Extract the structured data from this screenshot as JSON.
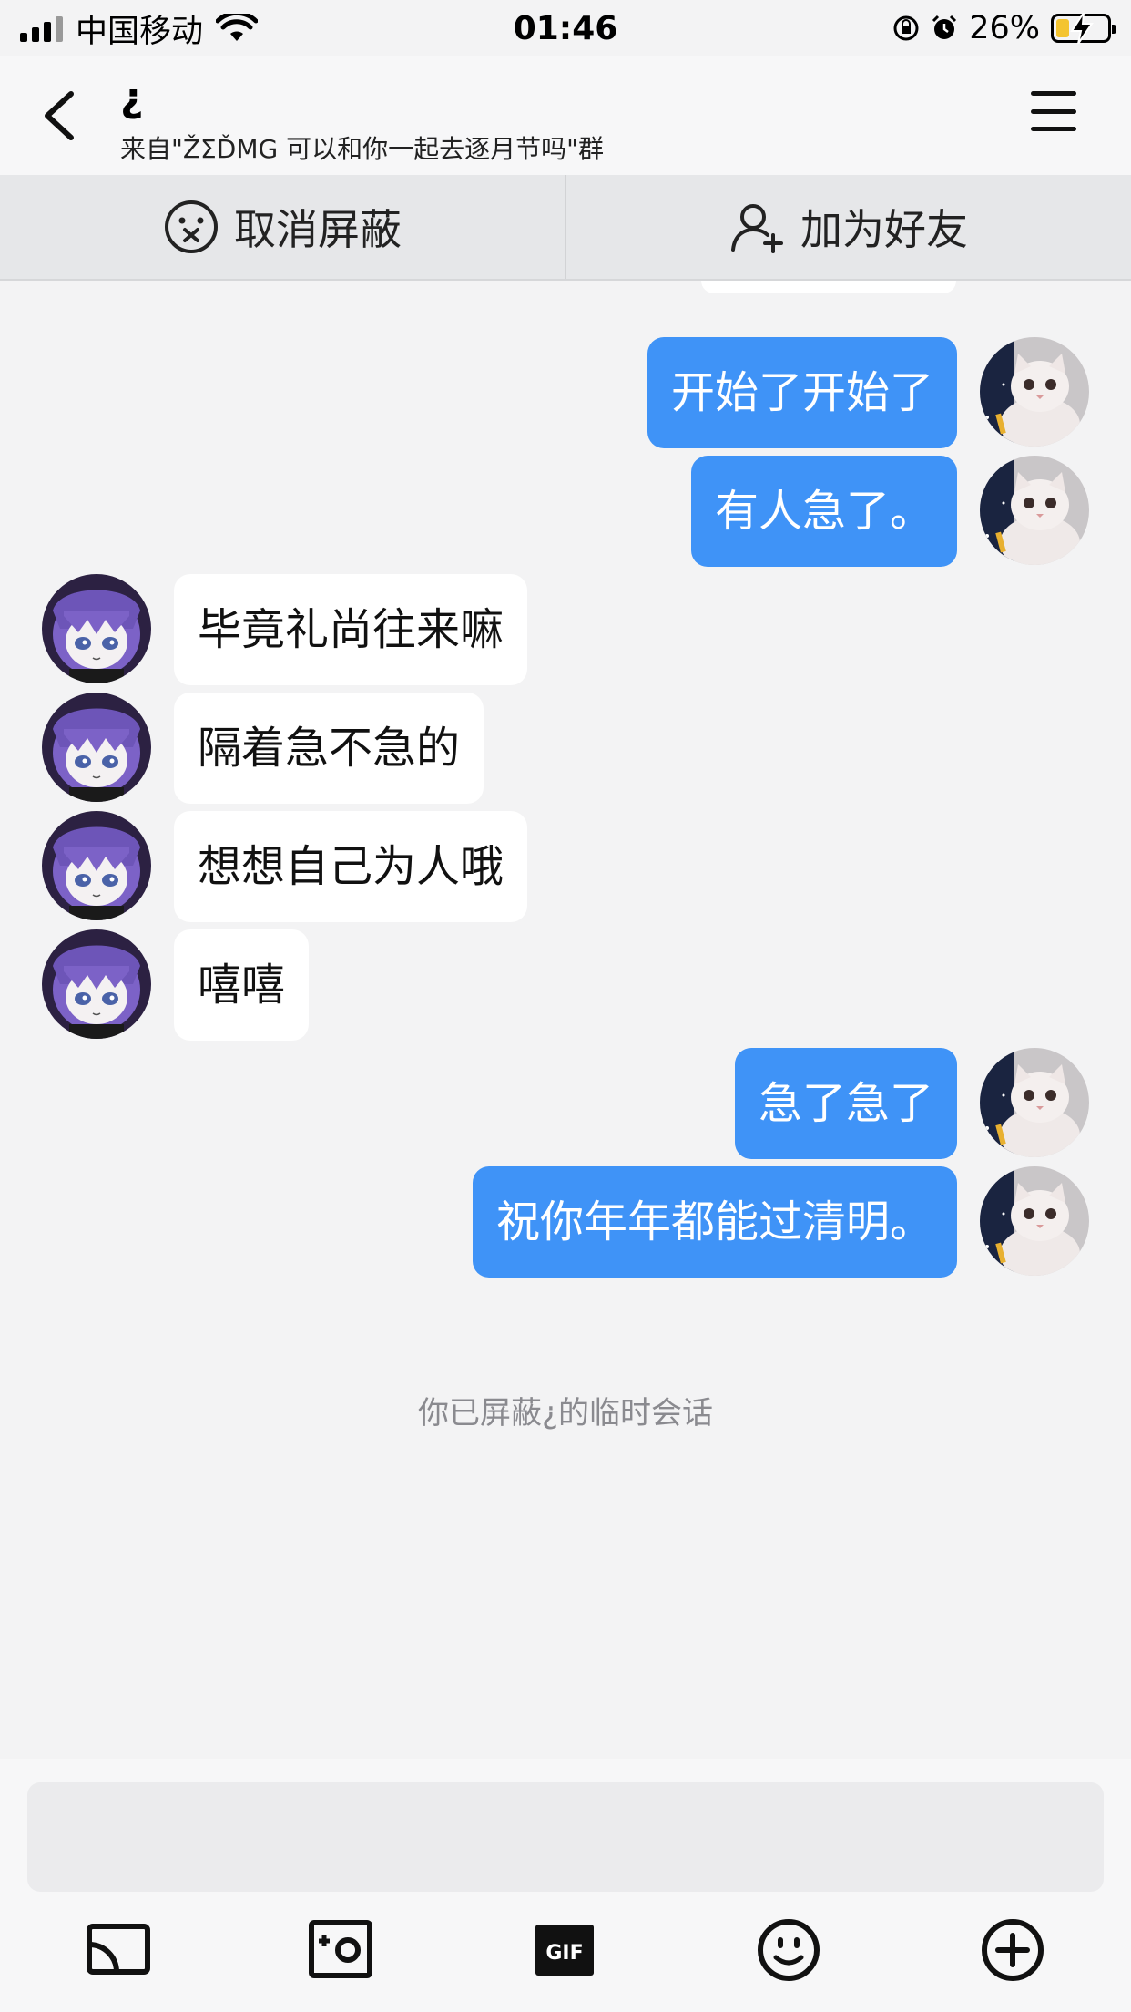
{
  "status": {
    "carrier": "中国移动",
    "time": "01:46",
    "battery": "26%",
    "battery_level": 0.26
  },
  "header": {
    "title": "¿",
    "subtitle": "来自\"ŽΣĎMG 可以和你一起去逐月节吗\"群"
  },
  "actions": {
    "unblock_label": "取消屏蔽",
    "add_friend_label": "加为好友"
  },
  "messages": [
    {
      "side": "me",
      "text": "开始了开始了"
    },
    {
      "side": "me",
      "text": "有人急了。"
    },
    {
      "side": "them",
      "text": "毕竟礼尚往来嘛"
    },
    {
      "side": "them",
      "text": "隔着急不急的"
    },
    {
      "side": "them",
      "text": "想想自己为人哦"
    },
    {
      "side": "them",
      "text": "嘻嘻"
    },
    {
      "side": "me",
      "text": "急了急了"
    },
    {
      "side": "me",
      "text": "祝你年年都能过清明。"
    }
  ],
  "notice": "你已屏蔽¿的临时会话",
  "input": {
    "value": ""
  },
  "toolbar": [
    "screen-share-icon",
    "photo-icon",
    "gif-icon",
    "emoji-icon",
    "plus-icon"
  ],
  "colors": {
    "my_bubble": "#3f93f7",
    "their_bubble": "#ffffff",
    "background": "#f3f3f4"
  }
}
